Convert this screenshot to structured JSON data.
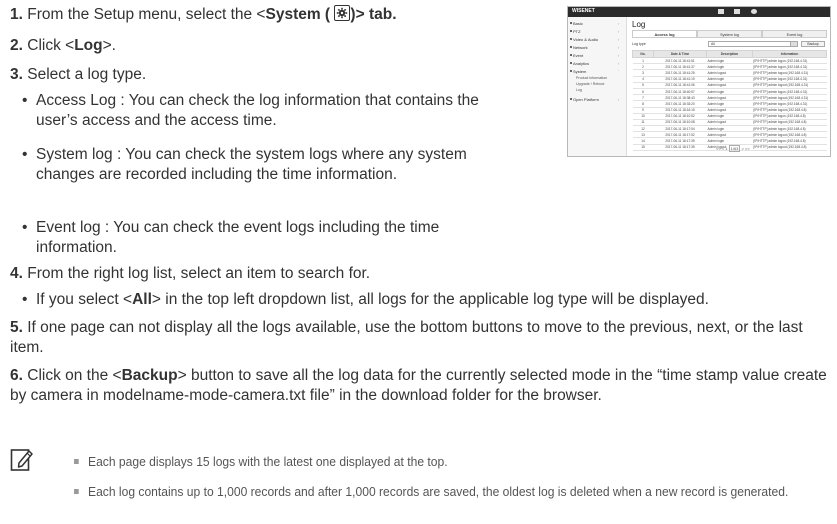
{
  "steps": [
    {
      "num": "1.",
      "pre": "From the Setup menu, select the <",
      "bold": "System (",
      "post": ")> tab."
    },
    {
      "num": "2.",
      "pre": "Click <",
      "bold": "Log",
      "post": ">."
    },
    {
      "num": "3.",
      "text": "Select a log type."
    },
    {
      "num": "4.",
      "text": "From the right log list, select an item to search for."
    },
    {
      "num": "5.",
      "text": "If one page can not display all the logs available, use the bottom buttons to move to the previous, next, or the last item."
    },
    {
      "num": "6.",
      "pre": "Click on the <",
      "bold": "Backup",
      "post": "> button to save all the log data for the currently selected mode in the “time stamp value create by camera in modelname-mode-camera.txt file” in the download folder for the browser."
    }
  ],
  "bullets3": [
    "Access Log : You can check the log information that contains the user’s access and the access time.",
    "System log : You can check the system logs where any system changes are recorded including the time information.",
    "Event log : You can check the event logs including the time information."
  ],
  "bullet4": {
    "pre": "If you select <",
    "bold": "All",
    "post": "> in the top left dropdown list, all logs for the applicable log type will be displayed."
  },
  "notes": [
    "Each page displays 15 logs with the latest one displayed at the top.",
    "Each log contains up to 1,000 records and after 1,000 records are saved, the oldest log is deleted when a new record is generated."
  ],
  "icons": {
    "system": "gear-icon",
    "note": "pencil-note-icon"
  },
  "screenshot": {
    "brand": "WISENET",
    "title": "Log",
    "sidebar": [
      "Basic",
      "PTZ",
      "Video & Audio",
      "Network",
      "Event",
      "Analytics",
      "System",
      "Open Platform"
    ],
    "system_sub": [
      "Product information",
      "Upgrade / Reboot",
      "Log"
    ],
    "tabs": [
      "Access log",
      "System log",
      "Event log"
    ],
    "log_type_label": "Log type",
    "select_value": "All",
    "backup": "Backup",
    "headers": [
      "No.",
      "Date & Time",
      "Description",
      "Information"
    ],
    "rows": [
      [
        "1",
        "2017-06-11 18:41:51",
        "Admin login",
        "[IP/HTTP] admin logon (192.168.4.31)"
      ],
      [
        "2",
        "2017-06-11 18:41:37",
        "Admin login",
        "[IP/HTTP] admin logon (192.168.4.31)"
      ],
      [
        "3",
        "2017-06-11 18:41:25",
        "Admin logout",
        "[IP/HTTP] admin logout (192.168.4.31)"
      ],
      [
        "4",
        "2017-06-11 18:41:19",
        "Admin login",
        "[IP/HTTP] admin logon (192.168.4.31)"
      ],
      [
        "5",
        "2017-06-11 18:41:06",
        "Admin logout",
        "[IP/HTTP] admin logout (192.168.4.31)"
      ],
      [
        "6",
        "2017-06-11 18:40:57",
        "Admin login",
        "[IP/HTTP] admin logon (192.168.4.31)"
      ],
      [
        "7",
        "2017-06-11 18:38:43",
        "Admin logout",
        "[IP/HTTP] admin logout (192.168.4.31)"
      ],
      [
        "8",
        "2017-06-11 18:33:20",
        "Admin login",
        "[IP/HTTP] admin logon (192.168.4.31)"
      ],
      [
        "9",
        "2017-06-11 18:16:15",
        "Admin logout",
        "[IP/HTTP] admin logout (192.168.4.8)"
      ],
      [
        "10",
        "2017-06-11 18:10:52",
        "Admin login",
        "[IP/HTTP] admin logon (192.168.4.8)"
      ],
      [
        "11",
        "2017-06-11 18:10:08",
        "Admin logout",
        "[IP/HTTP] admin logout (192.168.4.8)"
      ],
      [
        "12",
        "2017-06-11 18:17:54",
        "Admin login",
        "[IP/HTTP] admin logon (192.168.4.8)"
      ],
      [
        "13",
        "2017-06-11 18:17:52",
        "Admin logout",
        "[IP/HTTP] admin logout (192.168.4.8)"
      ],
      [
        "14",
        "2017-06-11 18:17:39",
        "Admin login",
        "[IP/HTTP] admin logon (192.168.4.8)"
      ],
      [
        "15",
        "2017-06-11 18:17:35",
        "Admin logout",
        "[IP/HTTP] admin logout (192.168.4.8)"
      ]
    ],
    "pager": {
      "first": "<<",
      "prev": "<",
      "page_num": "1",
      "page_sel": "1/63",
      "next": ">",
      "last": ">>"
    }
  }
}
